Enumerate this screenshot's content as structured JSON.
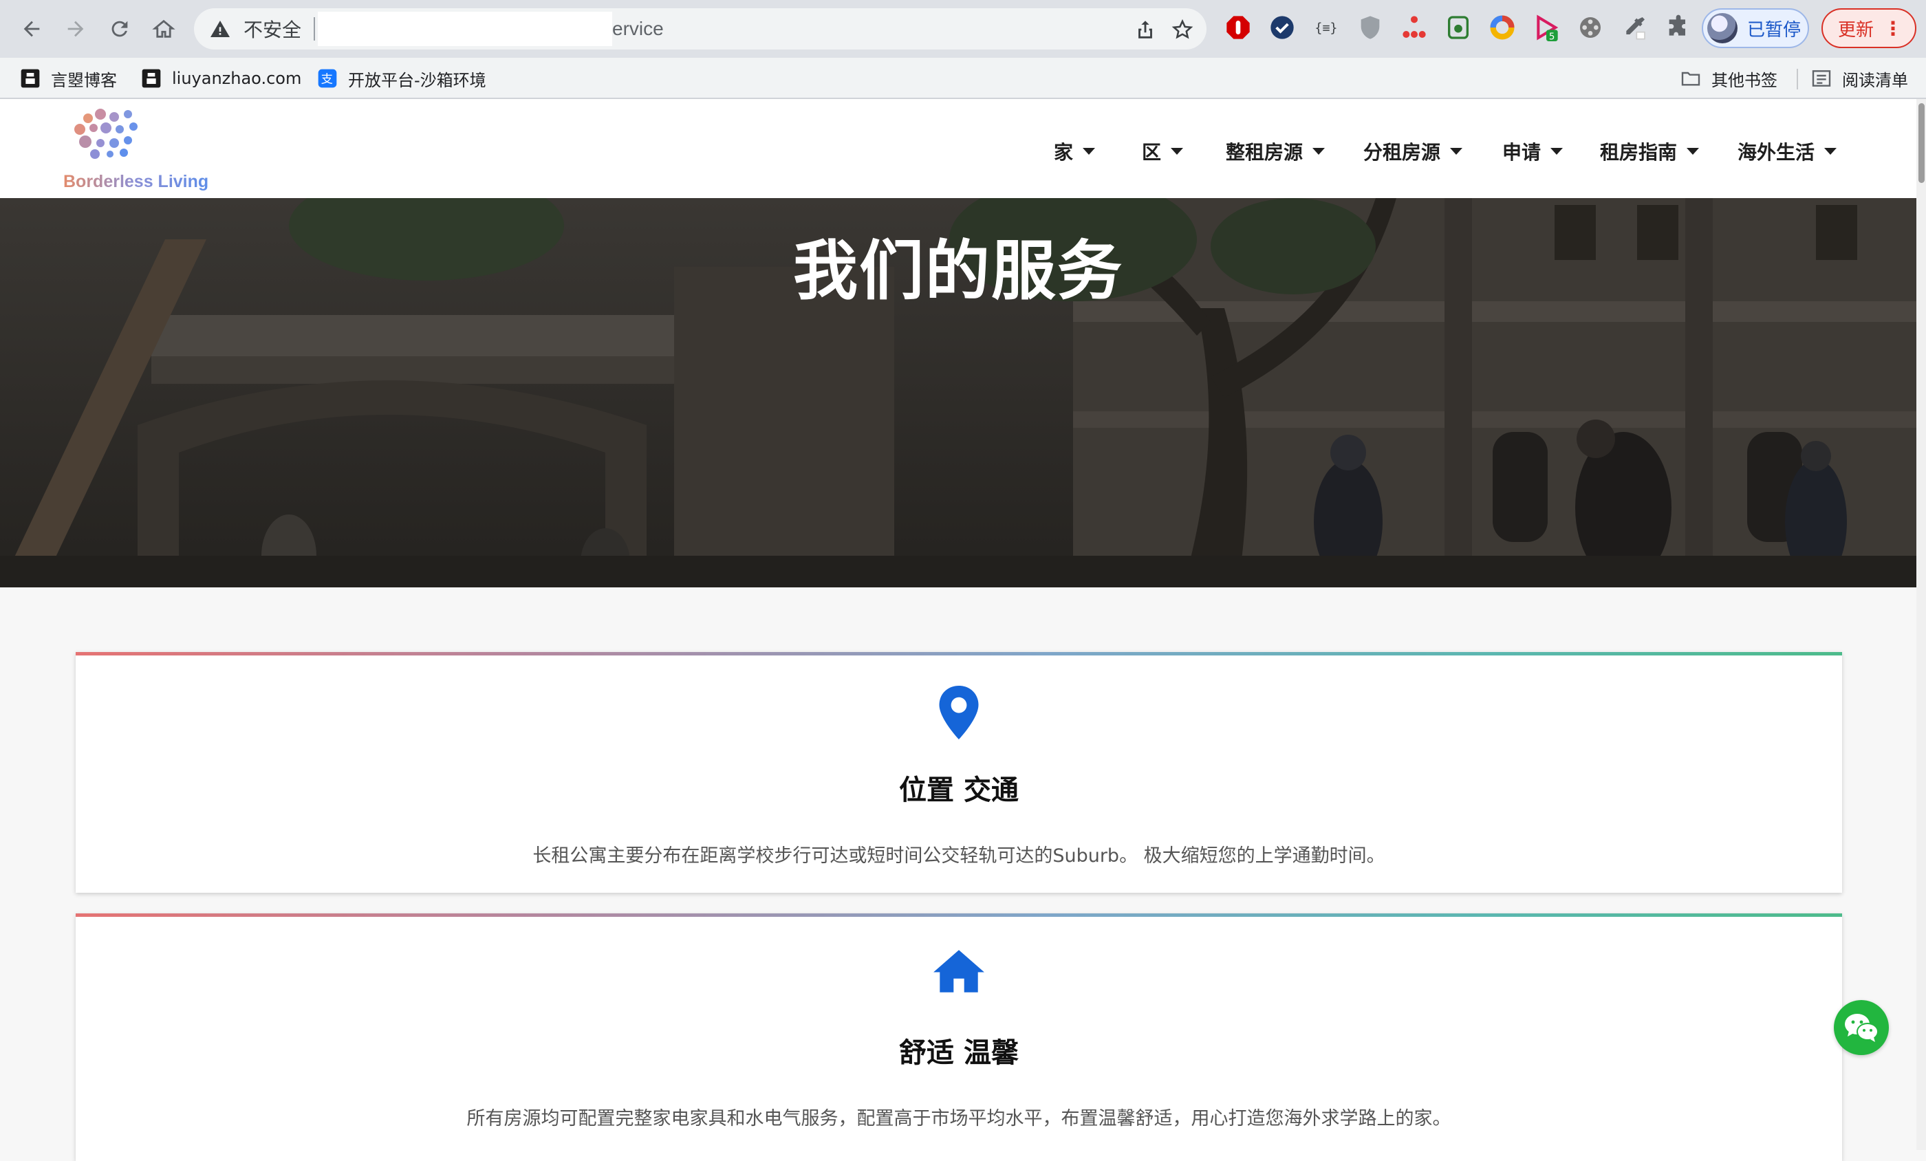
{
  "browser": {
    "security_label": "不安全",
    "url_visible_tail": "ervice",
    "profile_label": "已暂停",
    "update_label": "更新",
    "bookmarks": [
      {
        "label": "言曌博客",
        "icon": "bookmark-favicon"
      },
      {
        "label": "liuyanzhao.com",
        "icon": "bookmark-favicon"
      },
      {
        "label": "开放平台-沙箱环境",
        "icon": "alipay-icon"
      }
    ],
    "other_bookmarks": "其他书签",
    "reading_list": "阅读清单",
    "extension_badge": "5"
  },
  "site": {
    "logo_text": "Borderless Living",
    "nav": [
      "家",
      "区",
      "整租房源",
      "分租房源",
      "申请",
      "租房指南",
      "海外生活"
    ],
    "hero_title": "我们的服务",
    "cards": [
      {
        "icon": "map-pin-icon",
        "title": "位置 交通",
        "desc": "长租公寓主要分布在距离学校步行可达或短时间公交轻轨可达的Suburb。 极大缩短您的上学通勤时间。"
      },
      {
        "icon": "home-icon",
        "title": "舒适 温馨",
        "desc": "所有房源均可配置完整家电家具和水电气服务，配置高于市场平均水平，布置温馨舒适，用心打造您海外求学路上的家。"
      }
    ]
  },
  "colors": {
    "accent_blue": "#1565d8",
    "wechat_green": "#22b63f",
    "card_gradient": [
      "#e57373",
      "#7fa6c9",
      "#4dbb8b"
    ]
  }
}
